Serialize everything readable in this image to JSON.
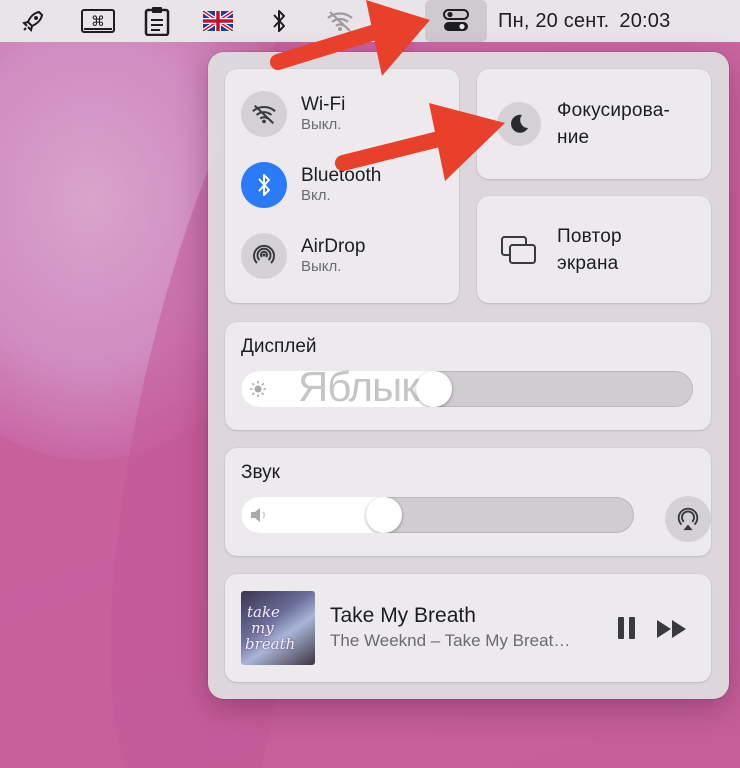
{
  "menubar": {
    "icons": [
      "rocket-icon",
      "command-keyboard-icon",
      "clipboard-icon",
      "uk-flag-icon",
      "bluetooth-icon",
      "wifi-off-icon",
      "control-center-icon"
    ],
    "date": "Пн, 20 сент.",
    "time": "20:03"
  },
  "control_center": {
    "connectivity": [
      {
        "name": "Wi-Fi",
        "status": "Выкл.",
        "icon": "wifi-off-icon",
        "active": false
      },
      {
        "name": "Bluetooth",
        "status": "Вкл.",
        "icon": "bluetooth-icon",
        "active": true
      },
      {
        "name": "AirDrop",
        "status": "Выкл.",
        "icon": "airdrop-icon",
        "active": false
      }
    ],
    "focus": {
      "label_line1": "Фокусирова-",
      "label_line2": "ние",
      "icon": "moon-icon"
    },
    "screen_mirroring": {
      "label_line1": "Повтор",
      "label_line2": "экрана",
      "icon": "screen-mirroring-icon"
    },
    "display": {
      "title": "Дисплей",
      "brightness": 0.42,
      "icon": "sun-icon"
    },
    "sound": {
      "title": "Звук",
      "volume": 0.35,
      "icon": "speaker-icon"
    },
    "now_playing": {
      "title": "Take My Breath",
      "subtitle": "The Weeknd – Take My Breat…",
      "album_art_text": [
        "take",
        "my",
        "breath"
      ]
    }
  },
  "watermark": "Яблык",
  "colors": {
    "accent_blue": "#2b7af7",
    "arrow_red": "#e8402a",
    "menubar_bg": "#e9e4e8",
    "panel_bg": "#dedcde"
  }
}
